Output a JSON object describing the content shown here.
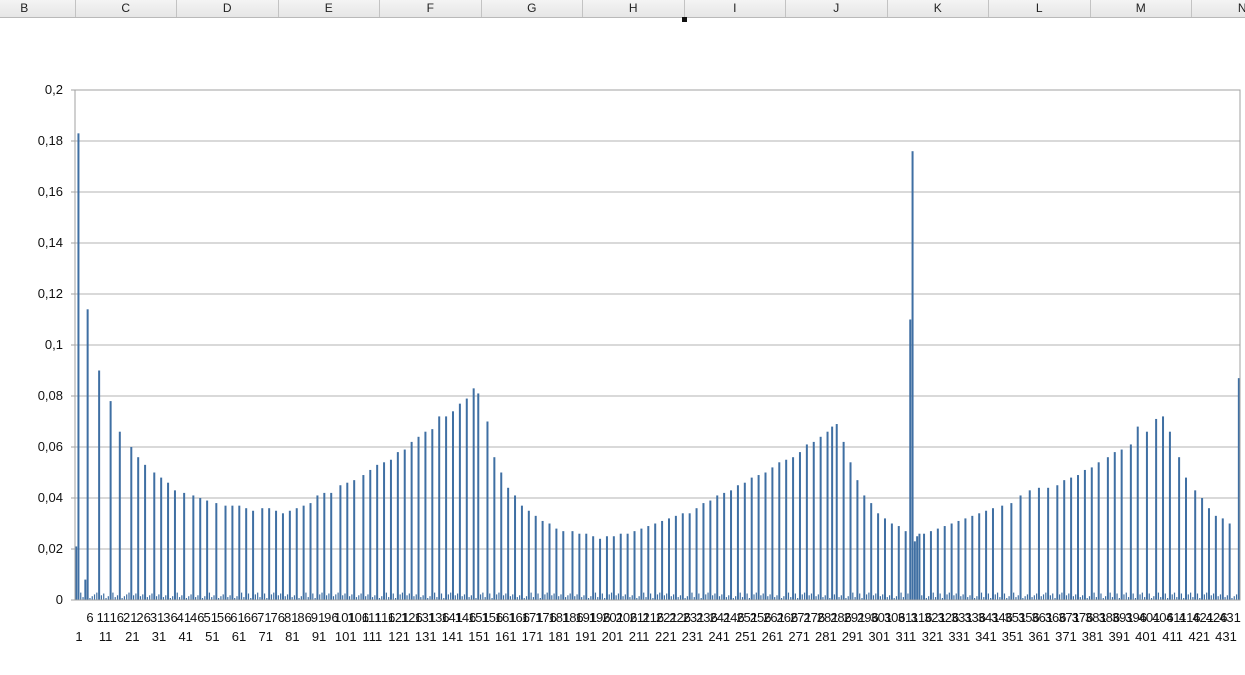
{
  "spreadsheet": {
    "columns": [
      "B",
      "C",
      "D",
      "E",
      "F",
      "G",
      "H",
      "I",
      "J",
      "K",
      "L",
      "M",
      "N"
    ]
  },
  "chart_data": {
    "type": "bar",
    "title": "",
    "xlabel": "",
    "ylabel": "",
    "ylim": [
      0,
      0.2
    ],
    "yticks": [
      "0",
      "0,02",
      "0,04",
      "0,06",
      "0,08",
      "0,1",
      "0,12",
      "0,14",
      "0,16",
      "0,18",
      "0,2"
    ],
    "grid": true,
    "legend": "none",
    "bar_color": "#3f6fa3",
    "x_range": [
      1,
      431
    ],
    "xtick_labels_row1": [
      "6",
      "11",
      "16",
      "21",
      "26",
      "31",
      "36",
      "41",
      "46",
      "51",
      "56",
      "61",
      "66",
      "71",
      "76",
      "81",
      "86",
      "91",
      "96",
      "101",
      "106",
      "111",
      "116",
      "121",
      "126",
      "131",
      "136",
      "141",
      "146",
      "151",
      "156",
      "161",
      "166",
      "171",
      "176",
      "181",
      "186",
      "191",
      "196",
      "201",
      "206",
      "211",
      "216",
      "221",
      "226",
      "231",
      "236",
      "241",
      "246",
      "251",
      "256",
      "261",
      "266",
      "271",
      "276",
      "281",
      "286",
      "291",
      "296",
      "301",
      "306",
      "311",
      "316",
      "321",
      "326",
      "331",
      "336",
      "341",
      "346",
      "351",
      "356",
      "361",
      "366",
      "371",
      "376",
      "381",
      "386",
      "391",
      "396",
      "401",
      "406",
      "411",
      "416",
      "421",
      "426",
      "431"
    ],
    "xtick_labels_row2": [
      "1",
      "11",
      "21",
      "31",
      "41",
      "51",
      "61",
      "71",
      "81",
      "91",
      "101",
      "111",
      "121",
      "131",
      "141",
      "151",
      "161",
      "171",
      "181",
      "191",
      "201",
      "211",
      "221",
      "231",
      "241",
      "251",
      "261",
      "271",
      "281",
      "291",
      "301",
      "311",
      "321",
      "331",
      "341",
      "351",
      "361",
      "371",
      "381",
      "391",
      "401",
      "411",
      "421",
      "431"
    ],
    "tall_bars": [
      [
        1,
        0.021
      ],
      [
        2,
        0.183
      ],
      [
        5,
        0.008
      ],
      [
        6,
        0.114
      ],
      [
        11,
        0.09
      ],
      [
        16,
        0.078
      ],
      [
        20,
        0.066
      ],
      [
        25,
        0.06
      ],
      [
        28,
        0.056
      ],
      [
        31,
        0.053
      ],
      [
        35,
        0.05
      ],
      [
        38,
        0.048
      ],
      [
        41,
        0.046
      ],
      [
        44,
        0.043
      ],
      [
        48,
        0.042
      ],
      [
        52,
        0.041
      ],
      [
        55,
        0.04
      ],
      [
        58,
        0.039
      ],
      [
        62,
        0.038
      ],
      [
        66,
        0.037
      ],
      [
        69,
        0.037
      ],
      [
        72,
        0.037
      ],
      [
        75,
        0.036
      ],
      [
        78,
        0.035
      ],
      [
        82,
        0.036
      ],
      [
        85,
        0.036
      ],
      [
        88,
        0.035
      ],
      [
        91,
        0.034
      ],
      [
        94,
        0.035
      ],
      [
        97,
        0.036
      ],
      [
        100,
        0.037
      ],
      [
        103,
        0.038
      ],
      [
        106,
        0.041
      ],
      [
        109,
        0.042
      ],
      [
        112,
        0.042
      ],
      [
        116,
        0.045
      ],
      [
        119,
        0.046
      ],
      [
        122,
        0.047
      ],
      [
        126,
        0.049
      ],
      [
        129,
        0.051
      ],
      [
        132,
        0.053
      ],
      [
        135,
        0.054
      ],
      [
        138,
        0.055
      ],
      [
        141,
        0.058
      ],
      [
        144,
        0.059
      ],
      [
        147,
        0.062
      ],
      [
        150,
        0.064
      ],
      [
        153,
        0.066
      ],
      [
        156,
        0.067
      ],
      [
        159,
        0.072
      ],
      [
        162,
        0.072
      ],
      [
        165,
        0.074
      ],
      [
        168,
        0.077
      ],
      [
        171,
        0.079
      ],
      [
        174,
        0.083
      ],
      [
        176,
        0.081
      ],
      [
        180,
        0.07
      ],
      [
        183,
        0.056
      ],
      [
        186,
        0.05
      ],
      [
        189,
        0.044
      ],
      [
        192,
        0.041
      ],
      [
        195,
        0.037
      ],
      [
        198,
        0.035
      ],
      [
        201,
        0.033
      ],
      [
        204,
        0.031
      ],
      [
        207,
        0.03
      ],
      [
        210,
        0.028
      ],
      [
        213,
        0.027
      ],
      [
        217,
        0.027
      ],
      [
        220,
        0.026
      ],
      [
        223,
        0.026
      ],
      [
        226,
        0.025
      ],
      [
        229,
        0.024
      ],
      [
        232,
        0.025
      ],
      [
        235,
        0.025
      ],
      [
        238,
        0.026
      ],
      [
        241,
        0.026
      ],
      [
        244,
        0.027
      ],
      [
        247,
        0.028
      ],
      [
        250,
        0.029
      ],
      [
        253,
        0.03
      ],
      [
        256,
        0.031
      ],
      [
        259,
        0.032
      ],
      [
        262,
        0.033
      ],
      [
        265,
        0.034
      ],
      [
        268,
        0.034
      ],
      [
        271,
        0.036
      ],
      [
        274,
        0.038
      ],
      [
        277,
        0.039
      ],
      [
        280,
        0.041
      ],
      [
        283,
        0.042
      ],
      [
        286,
        0.043
      ],
      [
        289,
        0.045
      ],
      [
        292,
        0.046
      ],
      [
        295,
        0.048
      ],
      [
        298,
        0.049
      ],
      [
        301,
        0.05
      ],
      [
        304,
        0.052
      ],
      [
        307,
        0.054
      ],
      [
        310,
        0.055
      ],
      [
        313,
        0.056
      ],
      [
        316,
        0.058
      ],
      [
        319,
        0.061
      ],
      [
        322,
        0.062
      ],
      [
        325,
        0.064
      ],
      [
        328,
        0.066
      ],
      [
        330,
        0.068
      ],
      [
        332,
        0.069
      ],
      [
        335,
        0.062
      ],
      [
        338,
        0.054
      ],
      [
        341,
        0.047
      ],
      [
        344,
        0.041
      ],
      [
        347,
        0.038
      ],
      [
        350,
        0.034
      ],
      [
        353,
        0.032
      ],
      [
        356,
        0.03
      ],
      [
        359,
        0.029
      ],
      [
        362,
        0.027
      ],
      [
        364,
        0.11
      ],
      [
        365,
        0.176
      ],
      [
        366,
        0.023
      ],
      [
        367,
        0.025
      ],
      [
        368,
        0.026
      ],
      [
        370,
        0.026
      ],
      [
        373,
        0.027
      ],
      [
        376,
        0.028
      ],
      [
        379,
        0.029
      ],
      [
        382,
        0.03
      ],
      [
        385,
        0.031
      ],
      [
        388,
        0.032
      ],
      [
        391,
        0.033
      ],
      [
        394,
        0.034
      ],
      [
        397,
        0.035
      ],
      [
        400,
        0.036
      ],
      [
        404,
        0.037
      ],
      [
        408,
        0.038
      ],
      [
        412,
        0.041
      ],
      [
        416,
        0.043
      ],
      [
        420,
        0.044
      ],
      [
        424,
        0.044
      ],
      [
        428,
        0.045
      ],
      [
        431,
        0.047
      ],
      [
        434,
        0.048
      ],
      [
        437,
        0.049
      ],
      [
        440,
        0.051
      ],
      [
        443,
        0.052
      ],
      [
        446,
        0.054
      ],
      [
        450,
        0.056
      ],
      [
        453,
        0.058
      ],
      [
        456,
        0.059
      ],
      [
        460,
        0.061
      ],
      [
        463,
        0.068
      ],
      [
        467,
        0.066
      ],
      [
        471,
        0.071
      ],
      [
        474,
        0.072
      ],
      [
        477,
        0.066
      ],
      [
        481,
        0.056
      ],
      [
        484,
        0.048
      ],
      [
        488,
        0.043
      ],
      [
        491,
        0.04
      ],
      [
        494,
        0.036
      ],
      [
        497,
        0.033
      ],
      [
        500,
        0.032
      ],
      [
        503,
        0.03
      ],
      [
        507,
        0.087
      ]
    ]
  }
}
